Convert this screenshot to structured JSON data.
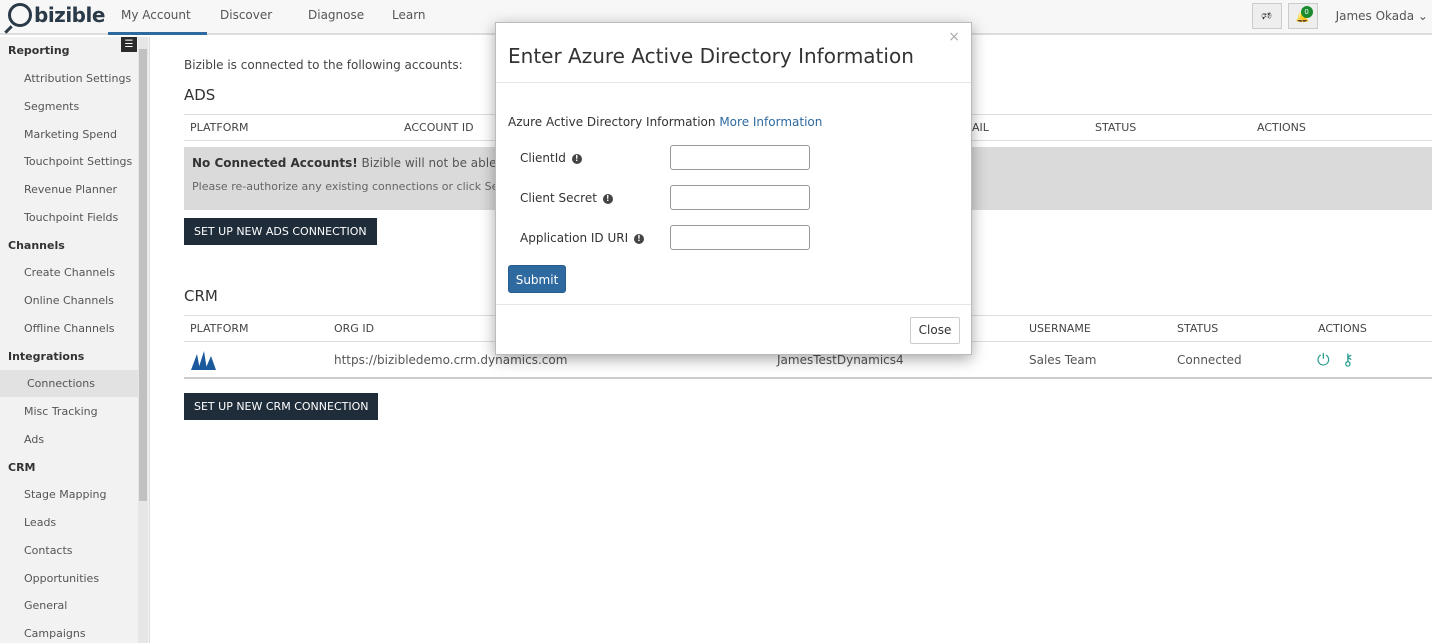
{
  "header": {
    "logo": "bizible",
    "nav": [
      {
        "label": "My Account ⌄"
      },
      {
        "label": "Discover"
      },
      {
        "label": "Diagnose"
      },
      {
        "label": "Learn"
      }
    ],
    "notifications_count": "0",
    "user_name": "James Okada ⌄"
  },
  "sidebar": {
    "groups": {
      "reporting": "Reporting",
      "channels": "Channels",
      "integrations": "Integrations",
      "crm": "CRM"
    },
    "reporting_items": [
      "Attribution Settings",
      "Segments",
      "Marketing Spend",
      "Touchpoint Settings",
      "Revenue Planner",
      "Touchpoint Fields"
    ],
    "channels_items": [
      "Create Channels",
      "Online Channels",
      "Offline Channels"
    ],
    "integrations_items": [
      "Connections",
      "Misc Tracking",
      "Ads"
    ],
    "crm_items": [
      "Stage Mapping",
      "Leads",
      "Contacts",
      "Opportunities",
      "General",
      "Campaigns"
    ]
  },
  "main": {
    "intro": "Bizible is connected to the following accounts:",
    "ads": {
      "title": "ADS",
      "headers": [
        "PLATFORM",
        "ACCOUNT ID",
        "AIL",
        "STATUS",
        "ACTIONS"
      ],
      "notice_bold": "No Connected Accounts!",
      "notice_rest": " Bizible will not be able to fully ana",
      "notice_line2": "Please re-authorize any existing connections or click Set Up",
      "button": "SET UP NEW ADS CONNECTION"
    },
    "crm": {
      "title": "CRM",
      "headers": [
        "PLATFORM",
        "ORG ID",
        "USERNAME",
        "STATUS",
        "ACTIONS"
      ],
      "row": {
        "org_id": "https://bizibledemo.crm.dynamics.com",
        "name": "JamesTestDynamics4",
        "username": "Sales Team",
        "status": "Connected"
      },
      "button": "SET UP NEW CRM CONNECTION"
    }
  },
  "modal": {
    "title": "Enter Azure Active Directory Information",
    "subtitle": "Azure Active Directory Information",
    "link": "More Information",
    "fields": {
      "client_id": {
        "label": "ClientId",
        "value": ""
      },
      "client_secret": {
        "label": "Client Secret",
        "value": ""
      },
      "app_id_uri": {
        "label": "Application ID URI",
        "value": ""
      }
    },
    "submit": "Submit",
    "close": "Close",
    "close_x": "×"
  },
  "colors": {
    "accent": "#2e6aa0",
    "dark_button": "#1f2d3b",
    "action_icon": "#2a9d8f",
    "badge": "#1a8c2f"
  }
}
